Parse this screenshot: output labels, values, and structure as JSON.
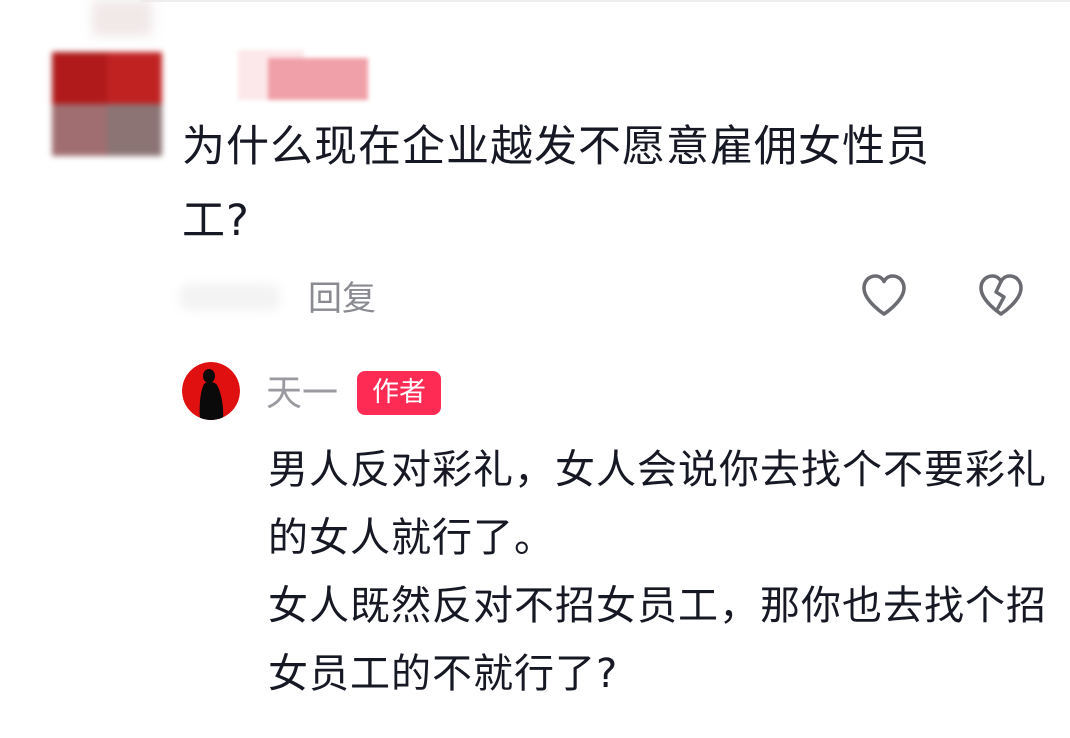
{
  "comment": {
    "text": "为什么现在企业越发不愿意雇佣女性员工?",
    "reply_label": "回复",
    "like_icon": "heart-outline-icon",
    "dislike_icon": "broken-heart-icon"
  },
  "reply": {
    "username": "天一",
    "badge": "作者",
    "paragraph_1": "男人反对彩礼，女人会说你去找个不要彩礼的女人就行了。",
    "paragraph_2": "女人既然反对不招女员工，那你也去找个招女员工的不就行了?"
  },
  "colors": {
    "badge_bg": "#fe2c55",
    "text_primary": "#161823",
    "text_secondary": "#8a8b91",
    "avatar_bg": "#e01010"
  }
}
